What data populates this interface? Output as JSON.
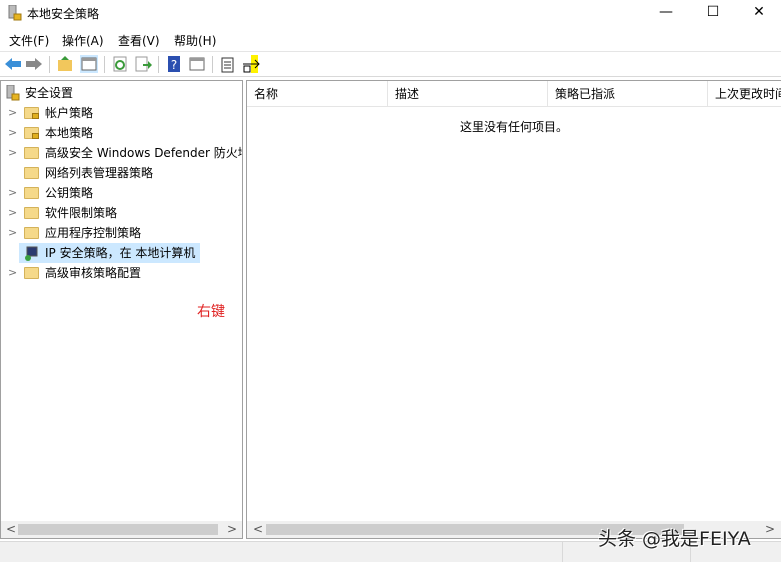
{
  "window": {
    "title": "本地安全策略",
    "minimize": "—",
    "maximize": "☐",
    "close": "✕"
  },
  "menu": [
    "文件(F)",
    "操作(A)",
    "查看(V)",
    "帮助(H)"
  ],
  "toolbar": [
    "back-icon",
    "forward-icon",
    "up-folder-icon",
    "show-hide-tree-icon",
    "refresh-icon",
    "export-icon",
    "help-icon",
    "show-action-pane-icon",
    "new-policy-icon",
    "add-icon"
  ],
  "tree": {
    "root": "安全设置",
    "items": [
      {
        "label": "帐户策略",
        "expandable": true
      },
      {
        "label": "本地策略",
        "expandable": true
      },
      {
        "label": "高级安全 Windows Defender 防火墙",
        "expandable": true
      },
      {
        "label": "网络列表管理器策略",
        "expandable": false
      },
      {
        "label": "公钥策略",
        "expandable": true
      },
      {
        "label": "软件限制策略",
        "expandable": true
      },
      {
        "label": "应用程序控制策略",
        "expandable": true
      },
      {
        "label": "IP 安全策略，在 本地计算机",
        "expandable": false,
        "selected": true
      },
      {
        "label": "高级审核策略配置",
        "expandable": true
      }
    ]
  },
  "annotation": "右键",
  "list": {
    "columns": [
      "名称",
      "描述",
      "策略已指派",
      "上次更改时间"
    ],
    "empty": "这里没有任何项目。"
  },
  "watermark": "头条 @我是FEIYA"
}
